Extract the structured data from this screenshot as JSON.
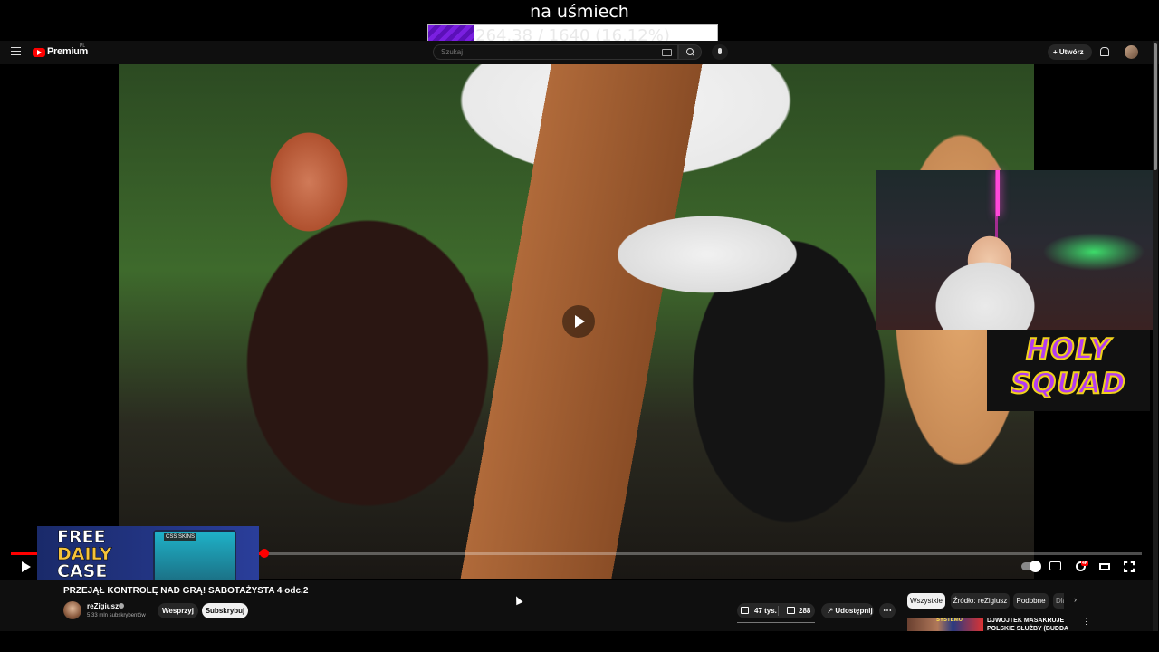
{
  "overlay": {
    "title": "na uśmiech",
    "goal_text": "264.38 / 1640 (16.12%)",
    "goal_progress": 0.1612,
    "goal_color": "#7a1fe0"
  },
  "masthead": {
    "logo_text": "Premium",
    "country_code": "PL",
    "search_placeholder": "Szukaj",
    "create_label": "Utwórz",
    "icons": [
      "menu-icon",
      "youtube-logo-icon",
      "keyboard-icon",
      "search-icon",
      "mic-icon",
      "plus-icon",
      "bell-icon",
      "avatar"
    ]
  },
  "player": {
    "progress": 0.2262,
    "progress_color": "#ff0000",
    "ad": {
      "line1": "FREE",
      "line2": "DAILY",
      "line3": "CASE",
      "case_label": "CSS SKINS"
    },
    "logo_line1": "HOLY",
    "logo_line2": "SQUAD",
    "settings_badge": "4K",
    "controls": [
      "play-icon",
      "autoplay-toggle",
      "subtitles-icon",
      "settings-icon",
      "theater-icon",
      "fullscreen-icon"
    ]
  },
  "video": {
    "title": "PRZEJĄŁ KONTROLĘ NAD GRĄ! SABOTAŻYSTA 4 odc.2",
    "channel": "reZigiusz",
    "subscribers": "5,33 mln subskrybentów",
    "support_label": "Wesprzyj",
    "subscribe_label": "Subskrybuj",
    "likes": "47 tys.",
    "dislikes": "288",
    "share_label": "Udostępnij",
    "more_label": "⋯"
  },
  "chips": [
    "Wszystkie",
    "Źródło: reZigiusz",
    "Podobne",
    "Dla Ciebie"
  ],
  "recommendation": {
    "thumb_label": "SYSTEMU",
    "title": "DJWOJTEK MASAKRUJE POLSKIE SŁUŻBY (BUDDA"
  }
}
